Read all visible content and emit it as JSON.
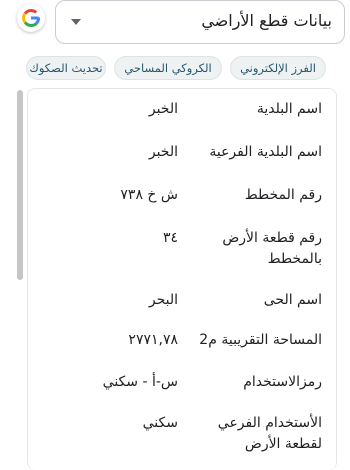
{
  "header": {
    "dropdown_value": "بيانات قطع الأراضي"
  },
  "icons": {
    "google": "google-icon",
    "dropdown": "chevron-down-icon"
  },
  "tabs": [
    {
      "label": "الفرز الإلكتروني"
    },
    {
      "label": "الكروكي المساحي"
    },
    {
      "label": "تحديث الصكوك"
    }
  ],
  "fields": [
    {
      "label": "اسم البلدية",
      "value": "الخبر"
    },
    {
      "label": "اسم البلدية الفرعية",
      "value": "الخبر"
    },
    {
      "label": "رقم المخطط",
      "value": "ش خ ٧٣٨"
    },
    {
      "label": "رقم قطعة الأرض بالمخطط",
      "value": "٣٤"
    },
    {
      "label": "اسم الحى",
      "value": "البحر"
    },
    {
      "label": "المساحة التقريبية م2",
      "value": "٢٧٧١,٧٨"
    },
    {
      "label": "رمزالاستخدام",
      "value": "س-أ - سكني"
    },
    {
      "label": "الأستخدام الفرعي لقطعة الأرض",
      "value": "سكني"
    }
  ],
  "colors": {
    "chip_text": "#27566b",
    "chip_bg": "#eef2f3",
    "border": "#c9ccd1"
  }
}
